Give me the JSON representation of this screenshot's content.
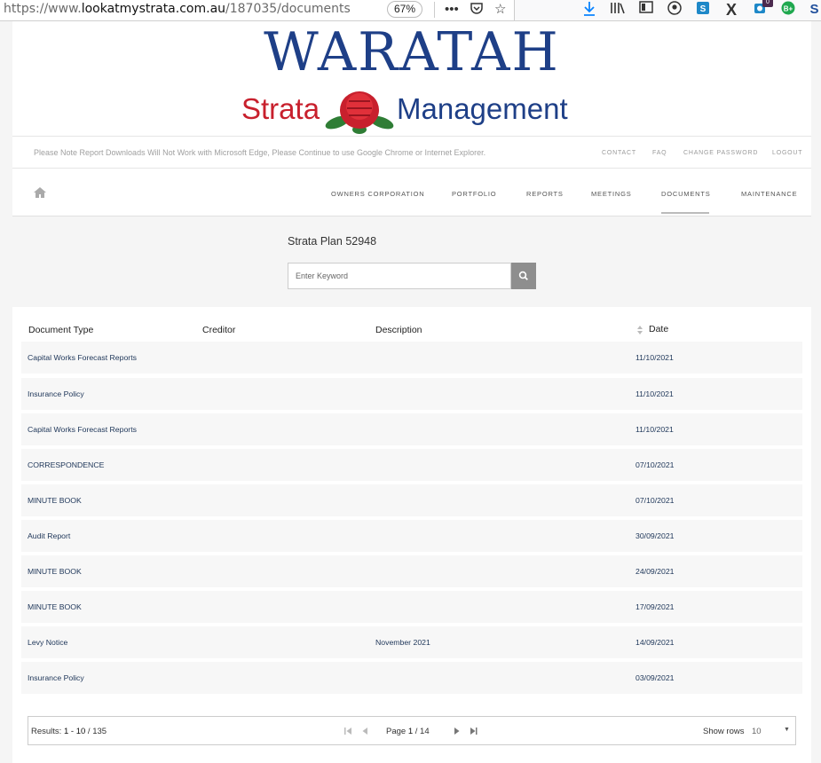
{
  "browser": {
    "url_prefix": "https://www.",
    "url_domain": "lookatmystrata.com.au",
    "url_path": "/187035/documents",
    "zoom": "67%",
    "badge_count": "0"
  },
  "logo": {
    "line1": "WARATAH",
    "word_left": "Strata",
    "word_right": "Management"
  },
  "notice": "Please Note Report Downloads Will Not Work with Microsoft Edge, Please Continue to use Google Chrome or Internet Explorer.",
  "top_links": [
    "CONTACT",
    "FAQ",
    "CHANGE PASSWORD",
    "LOGOUT"
  ],
  "nav": [
    "OWNERS CORPORATION",
    "PORTFOLIO",
    "REPORTS",
    "MEETINGS",
    "DOCUMENTS",
    "MAINTENANCE"
  ],
  "nav_active": "DOCUMENTS",
  "search": {
    "title": "Strata Plan 52948",
    "placeholder": "Enter Keyword"
  },
  "table": {
    "columns": [
      "Document Type",
      "Creditor",
      "Description",
      "Date"
    ],
    "rows": [
      {
        "type": "Capital Works Forecast Reports",
        "creditor": "",
        "description": "",
        "date": "11/10/2021"
      },
      {
        "type": "Insurance Policy",
        "creditor": "",
        "description": "",
        "date": "11/10/2021"
      },
      {
        "type": "Capital Works Forecast Reports",
        "creditor": "",
        "description": "",
        "date": "11/10/2021"
      },
      {
        "type": "CORRESPONDENCE",
        "creditor": "",
        "description": "",
        "date": "07/10/2021"
      },
      {
        "type": "MINUTE BOOK",
        "creditor": "",
        "description": "",
        "date": "07/10/2021"
      },
      {
        "type": "Audit Report",
        "creditor": "",
        "description": "",
        "date": "30/09/2021"
      },
      {
        "type": "MINUTE BOOK",
        "creditor": "",
        "description": "",
        "date": "24/09/2021"
      },
      {
        "type": "MINUTE BOOK",
        "creditor": "",
        "description": "",
        "date": "17/09/2021"
      },
      {
        "type": "Levy Notice",
        "creditor": "",
        "description": "November 2021",
        "date": "14/09/2021"
      },
      {
        "type": "Insurance Policy",
        "creditor": "",
        "description": "",
        "date": "03/09/2021"
      }
    ]
  },
  "pager": {
    "results_label": "Results:",
    "results_range": "1 - 10",
    "results_total": "135",
    "page_label": "Page",
    "page_current": "1",
    "page_total": "14",
    "show_rows_label": "Show rows",
    "rows_value": "10"
  },
  "colors": {
    "brand_blue": "#1e3f87",
    "brand_red": "#c8202d",
    "link_text": "#1d3558"
  }
}
